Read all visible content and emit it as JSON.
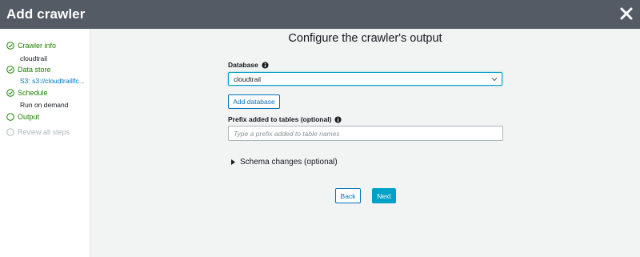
{
  "header": {
    "title": "Add crawler",
    "close_icon": "close-icon"
  },
  "colors": {
    "header_bg": "#545b64",
    "success": "#1d8102",
    "accent": "#00a1c9",
    "link": "#0073bb"
  },
  "sidebar": {
    "steps": [
      {
        "label": "Crawler info",
        "detail": "cloudtrail",
        "state": "done",
        "icon": "check-circle-icon"
      },
      {
        "label": "Data store",
        "detail": "S3: s3://cloudtraillfc...",
        "state": "done",
        "icon": "check-circle-icon"
      },
      {
        "label": "Schedule",
        "detail": "Run on demand",
        "state": "done",
        "icon": "check-circle-icon"
      },
      {
        "label": "Output",
        "detail": "",
        "state": "current",
        "icon": "circle-icon"
      },
      {
        "label": "Review all steps",
        "detail": "",
        "state": "future",
        "icon": "circle-icon"
      }
    ]
  },
  "main": {
    "title": "Configure the crawler's output",
    "database": {
      "label": "Database",
      "value": "cloudtrail"
    },
    "add_database_label": "Add database",
    "prefix": {
      "label": "Prefix added to tables (optional)",
      "placeholder": "Type a prefix added to table names"
    },
    "schema_changes_label": "Schema changes (optional)",
    "back_label": "Back",
    "next_label": "Next"
  }
}
